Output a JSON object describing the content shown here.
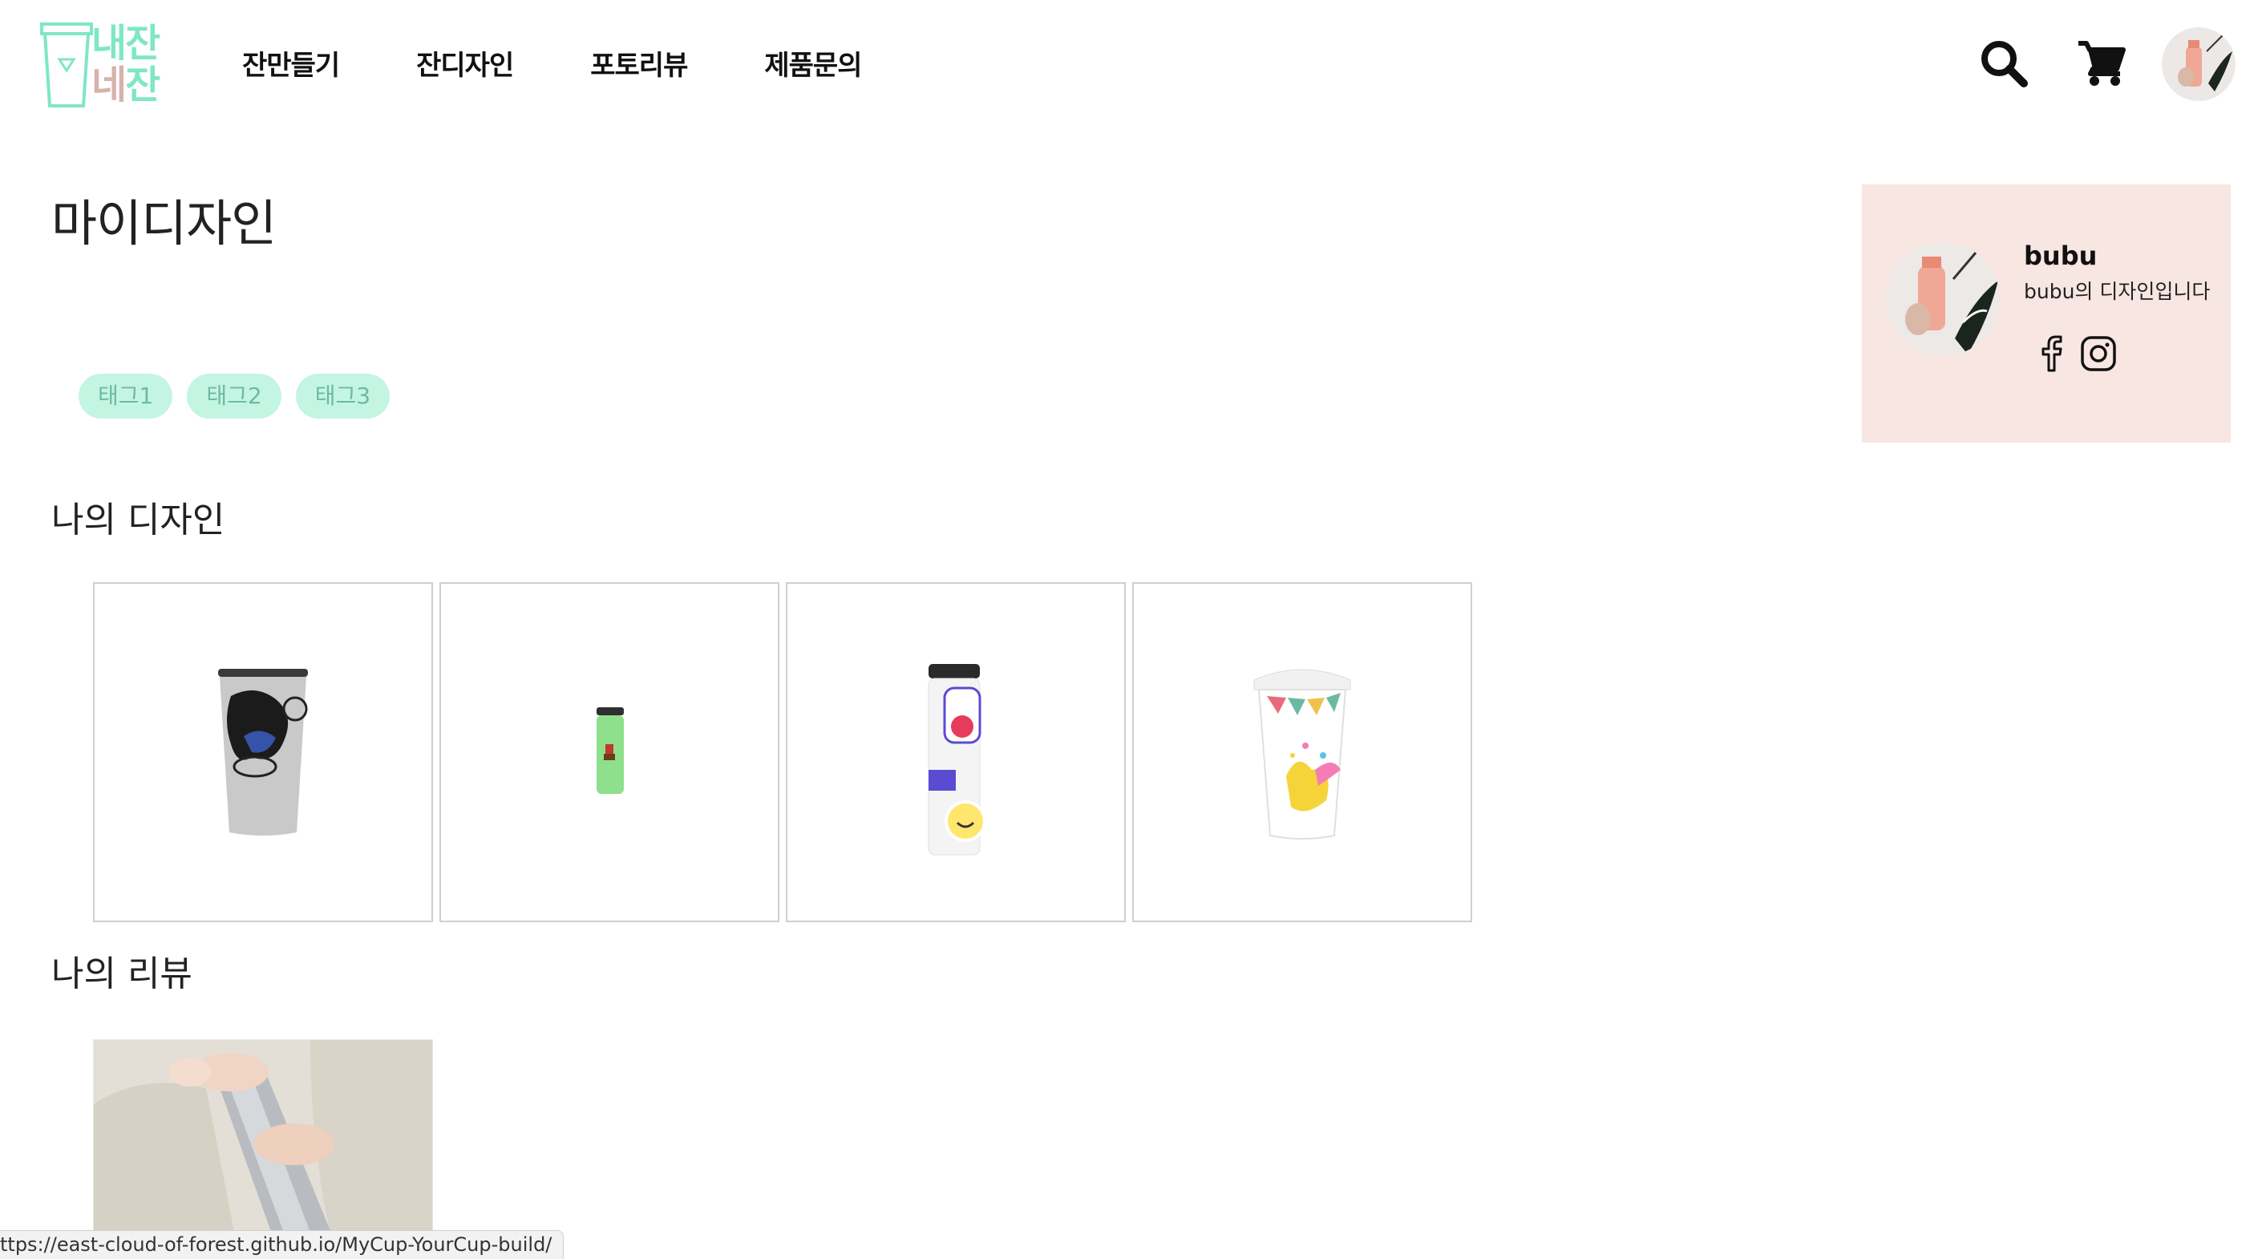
{
  "header": {
    "logo": {
      "line1": "내잔",
      "line2a": "네",
      "line2b": "잔"
    },
    "nav": [
      "잔만들기",
      "잔디자인",
      "포토리뷰",
      "제품문의"
    ],
    "icons": [
      "search-icon",
      "cart-icon"
    ]
  },
  "page": {
    "title": "마이디자인"
  },
  "tags": [
    "태그1",
    "태그2",
    "태그3"
  ],
  "sections": {
    "designs": "나의 디자인",
    "reviews": "나의 리뷰"
  },
  "designs": [
    "grey-tumbler-with-illustration",
    "green-bottle-with-pixel-character",
    "white-bottle-with-stickers",
    "white-cup-with-bunting"
  ],
  "reviews": [
    "hands-holding-steel-bottle"
  ],
  "profile": {
    "name": "bubu",
    "bio": "bubu의 디자인입니다",
    "social": [
      "facebook-icon",
      "instagram-icon"
    ]
  },
  "statusbar": {
    "url": "ttps://east-cloud-of-forest.github.io/MyCup-YourCup-build/"
  },
  "colors": {
    "mint": "#7fe6c6",
    "tag_bg": "#c4f5e3",
    "tag_text": "#6fb9a4",
    "profile_bg": "#f8e6e2"
  }
}
